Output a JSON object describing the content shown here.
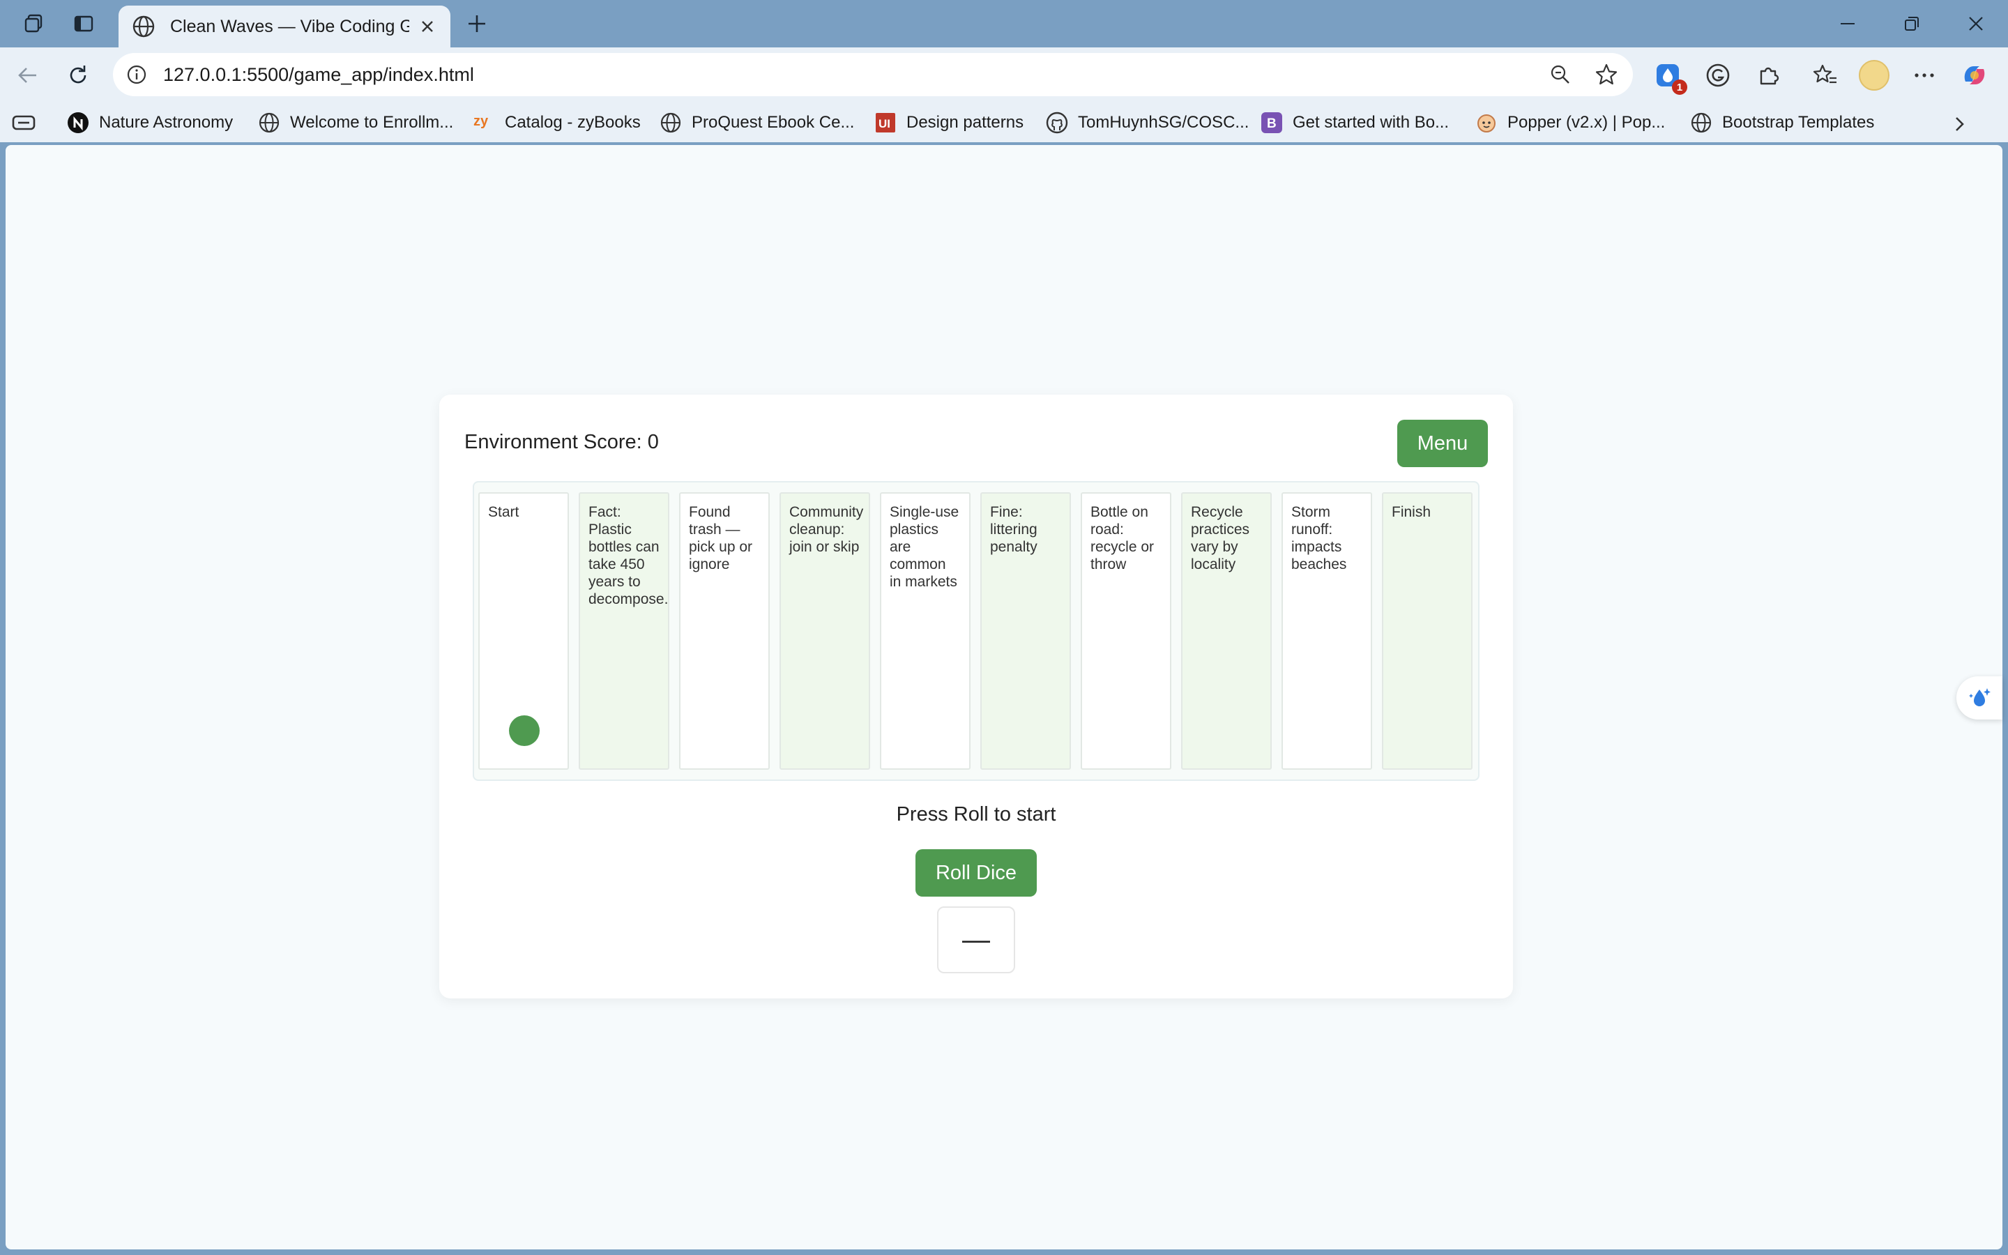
{
  "browser": {
    "tab": {
      "title": "Clean Waves — Vibe Coding Gam"
    },
    "address": {
      "url": "127.0.0.1:5500/game_app/index.html"
    },
    "extension_badge": "1",
    "bookmarks": [
      {
        "label": "Nature Astronomy",
        "icon": "nature-n-icon"
      },
      {
        "label": "Welcome to Enrollm...",
        "icon": "globe-icon"
      },
      {
        "label": "Catalog - zyBooks",
        "icon": "zybooks-icon"
      },
      {
        "label": "ProQuest Ebook Ce...",
        "icon": "globe-icon"
      },
      {
        "label": "Design patterns",
        "icon": "ui-icon"
      },
      {
        "label": "TomHuynhSG/COSC...",
        "icon": "github-icon"
      },
      {
        "label": "Get started with Bo...",
        "icon": "bootstrap-icon"
      },
      {
        "label": "Popper (v2.x) | Pop...",
        "icon": "popper-icon"
      },
      {
        "label": "Bootstrap Templates",
        "icon": "globe-icon"
      }
    ]
  },
  "game": {
    "score_label": "Environment Score: 0",
    "menu_label": "Menu",
    "cells": [
      "Start",
      "Fact: Plastic bottles can take 450 years to decompose.",
      "Found trash — pick up or ignore",
      "Community cleanup: join or skip",
      "Single-use plastics are common in markets",
      "Fine: littering penalty",
      "Bottle on road: recycle or throw",
      "Recycle practices vary by locality",
      "Storm runoff: impacts beaches",
      "Finish"
    ],
    "player_position": 0,
    "status": "Press Roll to start",
    "roll_label": "Roll Dice",
    "dice_value": "—"
  },
  "colors": {
    "accent": "#4f9a50",
    "frame": "#7a9fc2",
    "toolbar": "#e9f0f7",
    "page": "#f6fafc",
    "cell_green": "#eff8ec"
  }
}
